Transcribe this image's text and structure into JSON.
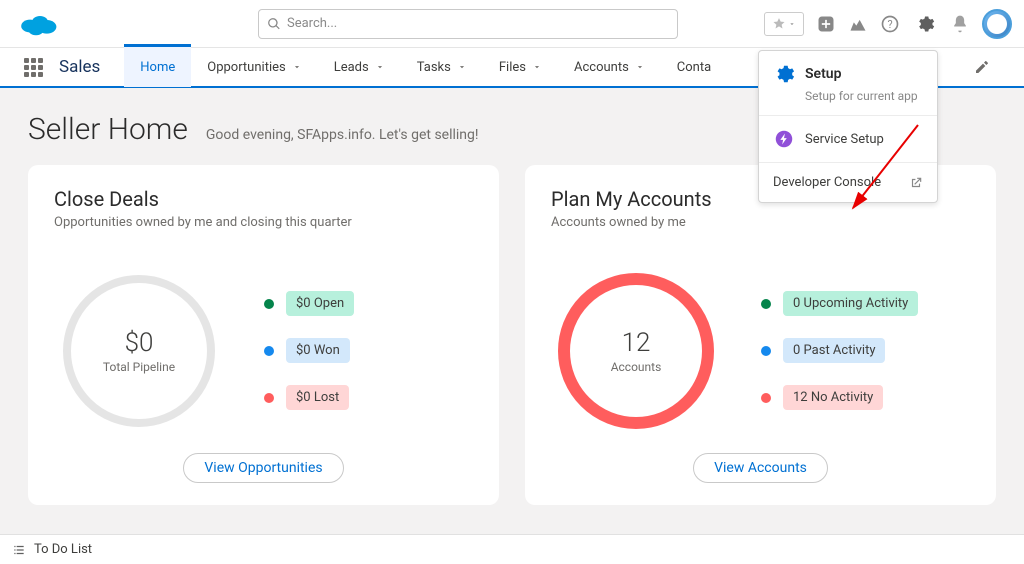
{
  "header": {
    "search_placeholder": "Search...",
    "app_name": "Sales"
  },
  "nav": {
    "items": [
      {
        "label": "Home",
        "active": true,
        "chevron": false
      },
      {
        "label": "Opportunities",
        "active": false,
        "chevron": true
      },
      {
        "label": "Leads",
        "active": false,
        "chevron": true
      },
      {
        "label": "Tasks",
        "active": false,
        "chevron": true
      },
      {
        "label": "Files",
        "active": false,
        "chevron": true
      },
      {
        "label": "Accounts",
        "active": false,
        "chevron": true
      },
      {
        "label": "Conta",
        "active": false,
        "chevron": true
      }
    ]
  },
  "page": {
    "title": "Seller Home",
    "subtitle": "Good evening, SFApps.info. Let's get selling!"
  },
  "cards": {
    "close_deals": {
      "title": "Close Deals",
      "subtitle": "Opportunities owned by me and closing this quarter",
      "ring_value": "$0",
      "ring_label": "Total Pipeline",
      "legend": [
        {
          "text": "$0 Open",
          "dot": "green",
          "pill": "green"
        },
        {
          "text": "$0 Won",
          "dot": "blue",
          "pill": "blue"
        },
        {
          "text": "$0 Lost",
          "dot": "red",
          "pill": "red"
        }
      ],
      "button": "View Opportunities"
    },
    "plan_accounts": {
      "title": "Plan My Accounts",
      "subtitle": "Accounts owned by me",
      "ring_value": "12",
      "ring_label": "Accounts",
      "legend": [
        {
          "text": "0 Upcoming Activity",
          "dot": "green",
          "pill": "green"
        },
        {
          "text": "0 Past Activity",
          "dot": "blue",
          "pill": "blue"
        },
        {
          "text": "12 No Activity",
          "dot": "red",
          "pill": "red"
        }
      ],
      "button": "View Accounts"
    }
  },
  "setup_menu": {
    "setup_label": "Setup",
    "setup_sub": "Setup for current app",
    "service_setup": "Service Setup",
    "developer_console": "Developer Console"
  },
  "footer": {
    "todo": "To Do List"
  },
  "colors": {
    "brand_blue": "#0070d2",
    "ring_red": "#ff5d5d",
    "ring_grey": "#e5e5e5"
  }
}
